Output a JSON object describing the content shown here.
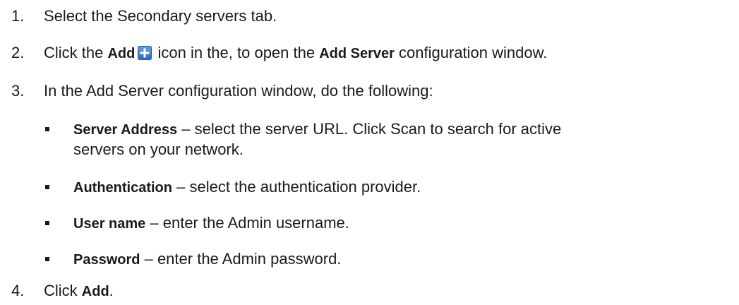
{
  "steps": [
    {
      "num": "1.",
      "text": "Select the Secondary servers tab."
    },
    {
      "num": "2.",
      "pre": "Click the ",
      "bold1": "Add",
      "mid": " icon in the, to open the ",
      "bold2": "Add Server",
      "post": " configuration window."
    },
    {
      "num": "3.",
      "text": "In the Add Server configuration window, do the following:"
    },
    {
      "num": "4.",
      "pre": "Click ",
      "bold": "Add",
      "post": "."
    }
  ],
  "bullets": [
    {
      "term": "Server Address",
      "line1": " – select the server URL. Click Scan to search for active",
      "line2": "servers on your network."
    },
    {
      "term": "Authentication",
      "text": " – select the authentication provider."
    },
    {
      "term": "User name",
      "text": " – enter the Admin username."
    },
    {
      "term": "Password",
      "text": " – enter the Admin password."
    }
  ],
  "icons": {
    "add": "add-plus-icon",
    "bullet": "square-bullet-icon"
  },
  "colors": {
    "text": "#1a1a1a",
    "icon_blue": "#3f79c4",
    "icon_border": "#2a5a9c"
  }
}
